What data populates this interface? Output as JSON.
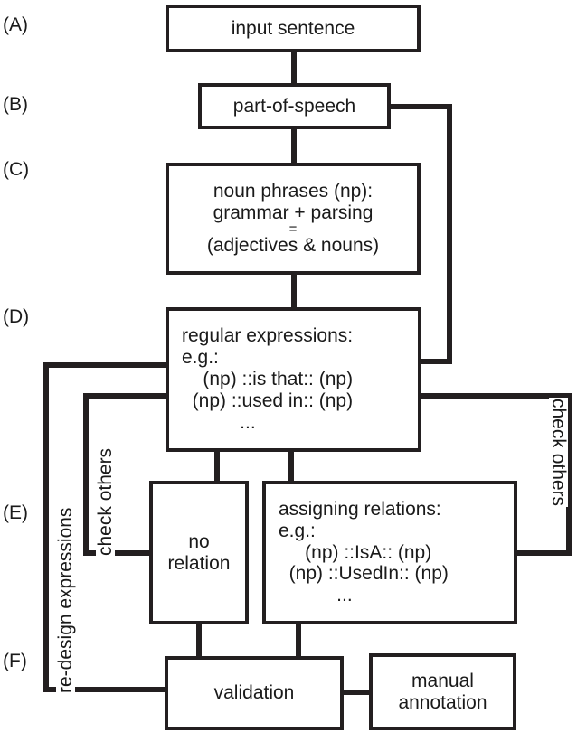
{
  "diagram": {
    "title": "NLP relation-extraction pipeline flowchart",
    "stage_labels": [
      {
        "id": "A",
        "text": "(A)"
      },
      {
        "id": "B",
        "text": "(B)"
      },
      {
        "id": "C",
        "text": "(C)"
      },
      {
        "id": "D",
        "text": "(D)"
      },
      {
        "id": "E",
        "text": "(E)"
      },
      {
        "id": "F",
        "text": "(F)"
      }
    ],
    "nodes": {
      "input_sentence": {
        "lines": [
          "input sentence"
        ]
      },
      "part_of_speech": {
        "lines": [
          "part-of-speech"
        ]
      },
      "noun_phrases": {
        "lines": [
          "noun phrases (np):",
          "grammar + parsing",
          "=",
          "(adjectives & nouns)"
        ]
      },
      "regular_expressions": {
        "lines": [
          "regular expressions:",
          "e.g.:",
          "    (np) ::is that:: (np)",
          "  (np) ::used in:: (np)",
          "           ..."
        ]
      },
      "no_relation": {
        "lines": [
          "no",
          "relation"
        ]
      },
      "assigning_relations": {
        "lines": [
          "assigning relations:",
          "e.g.:",
          "     (np) ::IsA:: (np)",
          "  (np) ::UsedIn:: (np)",
          "           ..."
        ]
      },
      "validation": {
        "lines": [
          "validation"
        ]
      },
      "manual_annotation": {
        "lines": [
          "manual",
          "annotation"
        ]
      }
    },
    "loop_labels": {
      "redesign_expressions": "re-design expressions",
      "check_others_left": "check others",
      "check_others_right": "check others"
    },
    "colors": {
      "stroke": "#231f20",
      "background": "#ffffff",
      "text": "#1a1a1a"
    }
  }
}
